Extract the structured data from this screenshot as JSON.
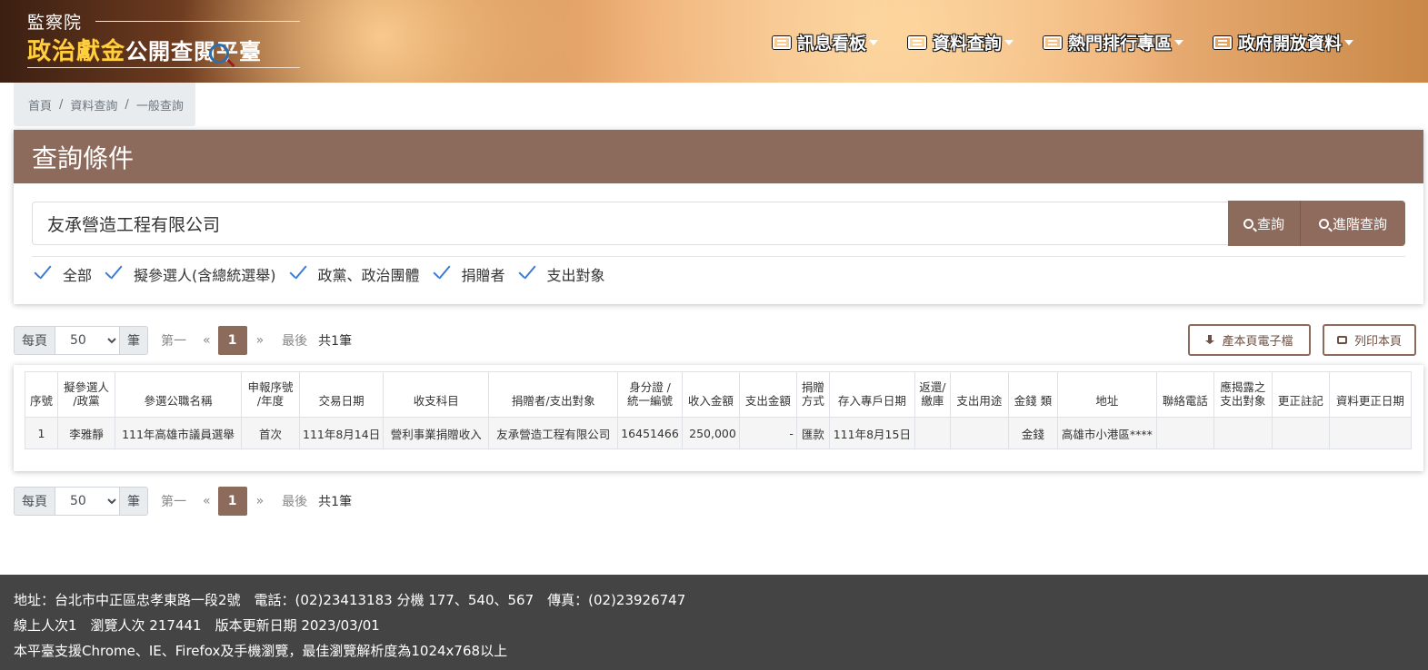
{
  "header": {
    "org": "監察院",
    "logo_highlight": "政治獻金",
    "logo_rest": "公開查閱平臺",
    "nav": [
      "訊息看板",
      "資料查詢",
      "熱門排行專區",
      "政府開放資料"
    ]
  },
  "breadcrumb": [
    "首頁",
    "資料查詢",
    "一般查詢"
  ],
  "query": {
    "title": "查詢條件",
    "search_value": "友承營造工程有限公司",
    "search_button": "查詢",
    "advanced_button": "進階查詢",
    "filters": [
      "全部",
      "擬參選人(含總統選舉)",
      "政黨、政治團體",
      "捐贈者",
      "支出對象"
    ]
  },
  "pagination": {
    "per_page_label": "每頁",
    "per_page_value": "50",
    "unit_label": "筆",
    "first": "第一",
    "prev": "«",
    "current": "1",
    "next": "»",
    "last": "最後",
    "total": "共1筆"
  },
  "actions": {
    "export": "產本頁電子檔",
    "print": "列印本頁"
  },
  "table": {
    "columns": [
      "序號",
      "擬參選人\n/政黨",
      "參選公職名稱",
      "申報序號\n/年度",
      "交易日期",
      "收支科目",
      "捐贈者/支出對象",
      "身分證 /\n統一編號",
      "收入金額",
      "支出金額",
      "捐贈\n方式",
      "存入專戶日期",
      "返還/\n繳庫",
      "支出用途",
      "金錢 類",
      "地址",
      "聯絡電話",
      "應揭露之\n支出對象",
      "更正註記",
      "資料更正日期"
    ],
    "rows": [
      [
        "1",
        "李雅靜",
        "111年高雄市議員選舉",
        "首次",
        "111年8月14日",
        "營利事業捐贈收入",
        "友承營造工程有限公司",
        "16451466",
        "250,000",
        "-",
        "匯款",
        "111年8月15日",
        "",
        "",
        "金錢",
        "高雄市小港區****",
        "",
        "",
        "",
        ""
      ]
    ]
  },
  "footer": {
    "line1": "地址：台北市中正區忠孝東路一段2號　電話：(02)23413183 分機 177、540、567　傳真：(02)23926747",
    "line2": "線上人次1　瀏覽人次 217441　版本更新日期 2023/03/01",
    "line3": "本平臺支援Chrome、IE、Firefox及手機瀏覽，最佳瀏覽解析度為1024x768以上"
  }
}
